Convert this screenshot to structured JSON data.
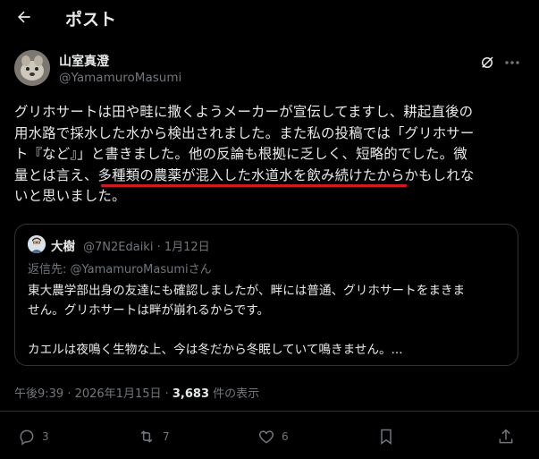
{
  "header": {
    "title": "ポスト"
  },
  "post": {
    "author": {
      "display_name": "山室真澄",
      "handle": "@YamamuroMasumi"
    },
    "text_lines": [
      "グリホサートは田や畦に撒くようメーカーが宣伝してますし、耕起直後の",
      "用水路で採水した水から検出されました。また私の投稿では「グリホサー",
      "ト『など』」と書きました。他の反論も根拠に乏しく、短略的でした。微",
      "量とは言え、多種類の農薬が混入した水道水を飲み続けたからかもしれな",
      "いと思いました。"
    ],
    "timestamp": "午後9:39 · 2026年1月15日 · ",
    "views_count": "3,683",
    "views_label": " 件の表示"
  },
  "quote": {
    "name": "大樹",
    "meta": "@7N2Edaiki · 1月12日",
    "reply_prefix": "返信先: ",
    "reply_mention": "@YamamuroMasumi",
    "reply_suffix": "さん",
    "text_lines": [
      "東大農学部出身の友達にも確認しましたが、畔には普通、グリホサートをまきま",
      "せん。グリホサートは畔が崩れるからです。",
      "",
      "カエルは夜鳴く生物な上、今は冬だから冬眠していて鳴きません。..."
    ]
  },
  "actions": {
    "replies": "3",
    "reposts": "7",
    "likes": "6"
  },
  "colors": {
    "background": "#000000",
    "text": "#e7e9ea",
    "muted": "#71767b",
    "underline": "#d01a22",
    "border": "#2f3336"
  }
}
